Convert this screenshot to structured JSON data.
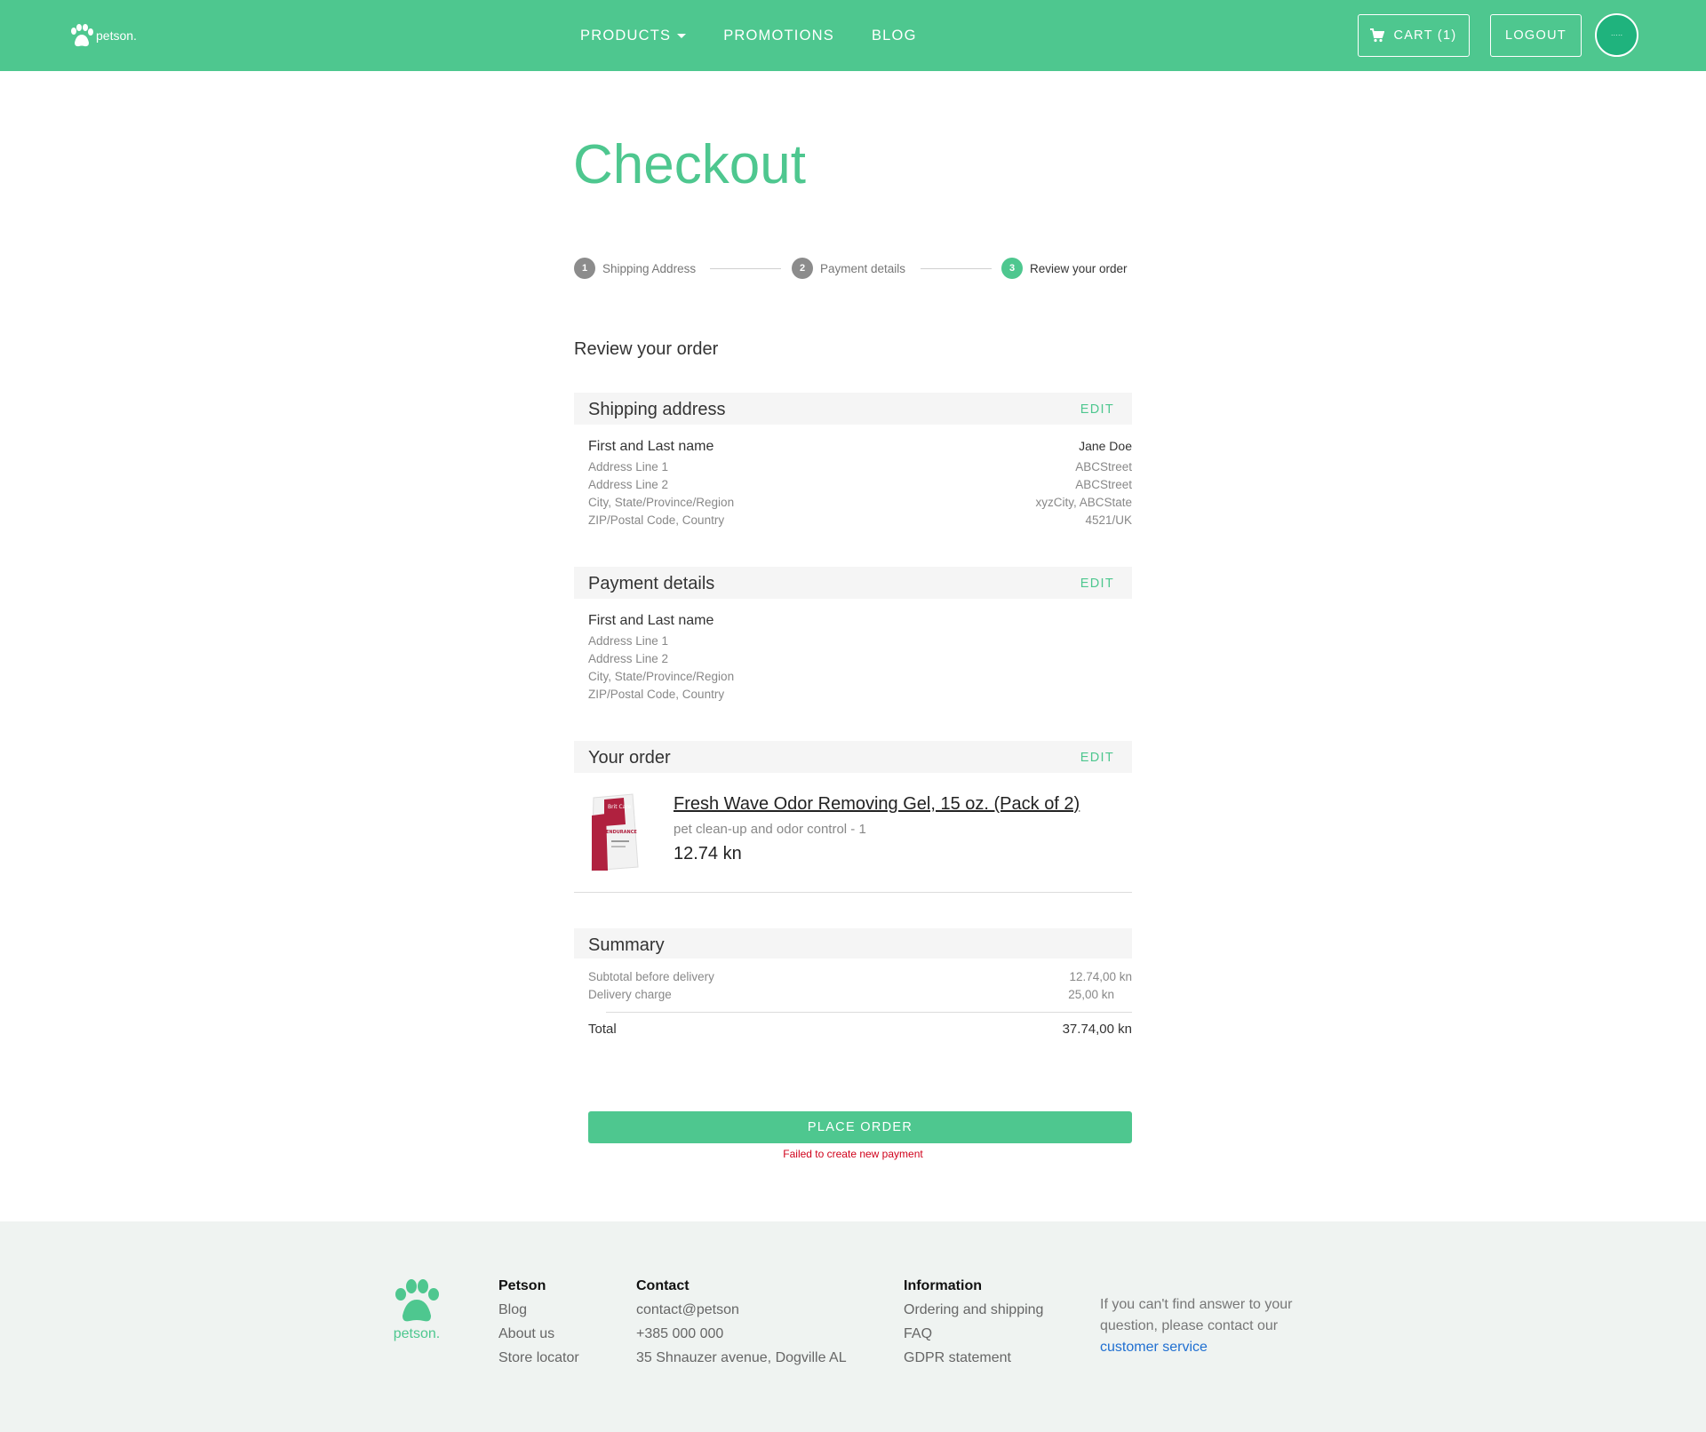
{
  "header": {
    "logo_text": "petson.",
    "nav": [
      "PRODUCTS",
      "PROMOTIONS",
      "BLOG"
    ],
    "cart_label": "CART (1)",
    "logout_label": "LOGOUT",
    "avatar_text": "·····",
    "accent_color": "#4ec78f"
  },
  "page": {
    "title": "Checkout",
    "steps": [
      {
        "num": "1",
        "label": "Shipping Address"
      },
      {
        "num": "2",
        "label": "Payment details"
      },
      {
        "num": "3",
        "label": "Review your order"
      }
    ],
    "section_heading": "Review your order"
  },
  "shipping": {
    "title": "Shipping address",
    "edit": "EDIT",
    "rows": [
      {
        "k": "First and Last name",
        "v": "Jane Doe"
      },
      {
        "k": "Address Line 1",
        "v": "ABCStreet"
      },
      {
        "k": "Address Line 2",
        "v": "ABCStreet"
      },
      {
        "k": "City, State/Province/Region",
        "v": "xyzCity, ABCState"
      },
      {
        "k": "ZIP/Postal Code, Country",
        "v": "4521/UK"
      }
    ]
  },
  "payment": {
    "title": "Payment details",
    "edit": "EDIT",
    "rows": [
      {
        "k": "First and Last name",
        "v": ""
      },
      {
        "k": "Address Line 1",
        "v": ""
      },
      {
        "k": "Address Line 2",
        "v": ""
      },
      {
        "k": "City, State/Province/Region",
        "v": ""
      },
      {
        "k": "ZIP/Postal Code, Country",
        "v": ""
      }
    ]
  },
  "order": {
    "title": "Your order",
    "edit": "EDIT",
    "product_name": "Fresh Wave Odor Removing Gel, 15 oz. (Pack of 2)",
    "product_category": "pet clean-up and odor control - 1",
    "product_price": "12.74 kn",
    "product_image_brand": "Brit Care",
    "product_image_label": "ENDURANCE"
  },
  "summary": {
    "title": "Summary",
    "subtotal_label": "Subtotal before delivery",
    "subtotal_value": "12.74,00 kn",
    "delivery_label": "Delivery charge",
    "delivery_value": "25,00 kn",
    "total_label": "Total",
    "total_value": "37.74,00 kn"
  },
  "actions": {
    "place_order": "PLACE ORDER",
    "error": "Failed to create new payment"
  },
  "footer": {
    "logo_text": "petson.",
    "petson": {
      "heading": "Petson",
      "links": [
        "Blog",
        "About us",
        "Store locator"
      ]
    },
    "contact": {
      "heading": "Contact",
      "lines": [
        "contact@petson",
        "+385 000 000",
        "35 Shnauzer avenue, Dogville AL"
      ]
    },
    "information": {
      "heading": "Information",
      "links": [
        "Ordering and shipping",
        "FAQ",
        "GDPR statement"
      ]
    },
    "help_text": "If you can't find answer to your question, please contact our",
    "help_link": "customer service"
  }
}
